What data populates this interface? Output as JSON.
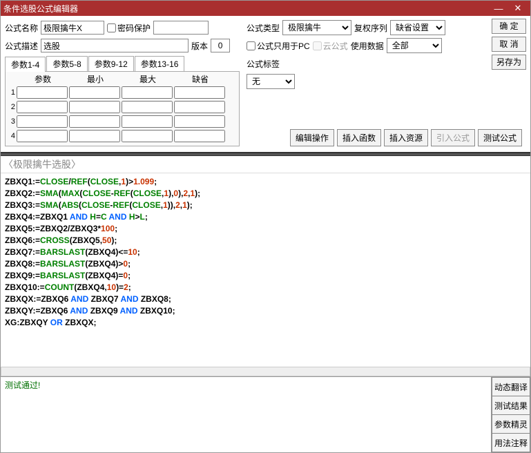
{
  "title": "条件选股公式编辑器",
  "labels": {
    "name": "公式名称",
    "desc": "公式描述",
    "pwd": "密码保护",
    "type": "公式类型",
    "fq": "复权序列",
    "pconly": "公式只用于PC",
    "cloud": "云公式",
    "usedata": "使用数据",
    "ver": "版本",
    "tag": "公式标签"
  },
  "values": {
    "name": "极限擒牛X",
    "desc": "选股",
    "ver": "0",
    "type": "极限擒牛",
    "fq": "缺省设置",
    "usedata": "全部",
    "tag": "无"
  },
  "buttons": {
    "ok": "确 定",
    "cancel": "取 消",
    "saveas": "另存为",
    "editop": "编辑操作",
    "insfn": "插入函数",
    "insres": "插入资源",
    "impform": "引入公式",
    "testform": "测试公式"
  },
  "tabs": [
    "参数1-4",
    "参数5-8",
    "参数9-12",
    "参数13-16"
  ],
  "paramhdr": [
    "参数",
    "最小",
    "最大",
    "缺省"
  ],
  "paramrows": [
    "1",
    "2",
    "3",
    "4"
  ],
  "codeTitle": "〈极限擒牛选股〉",
  "status": "测试通过!",
  "sidebtns": [
    "动态翻译",
    "测试结果",
    "参数精灵",
    "用法注释"
  ]
}
